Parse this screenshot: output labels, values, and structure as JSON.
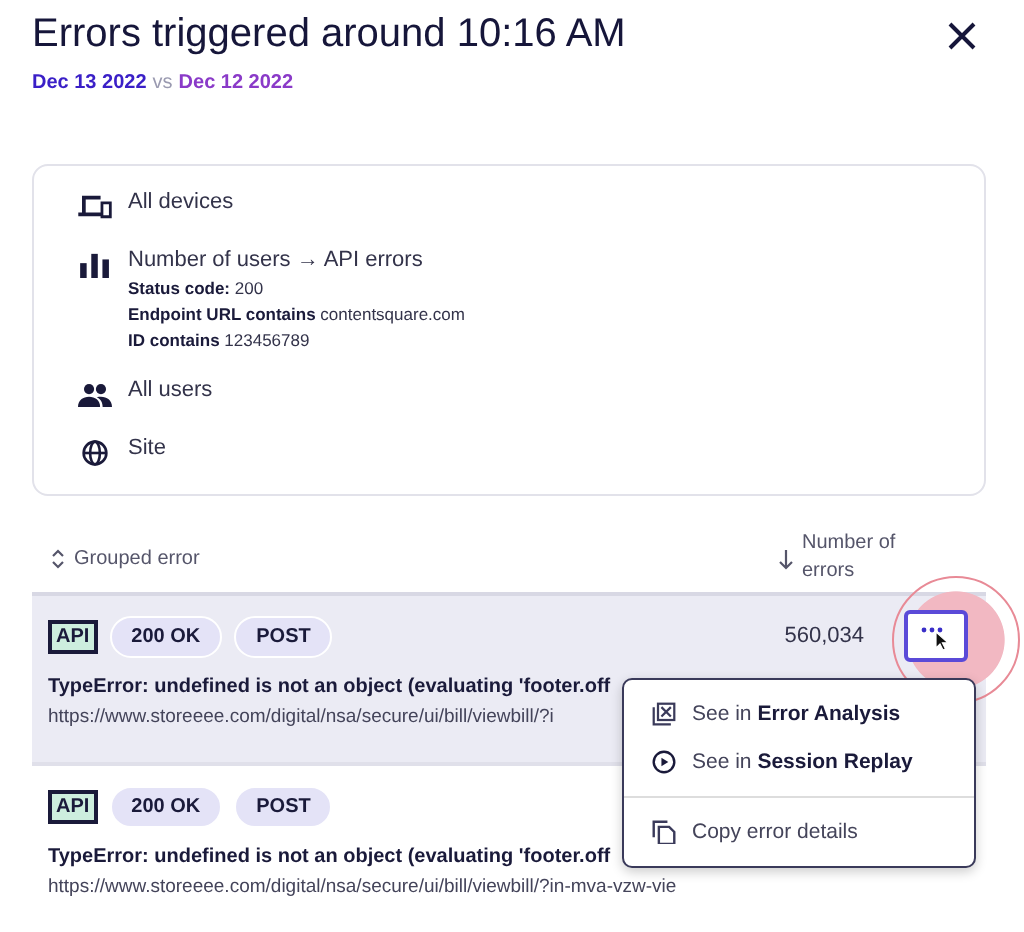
{
  "title": "Errors triggered around 10:16 AM",
  "comparison": {
    "current": "Dec 13 2022",
    "separator": "vs",
    "previous": "Dec 12 2022"
  },
  "filters": [
    {
      "kind": "devices",
      "label": "All devices"
    },
    {
      "kind": "metric",
      "label": "Number of users → API errors",
      "conditions": [
        "**Status code:** 200",
        "**Endpoint URL contains** contentsquare.com",
        "**ID contains** 123456789"
      ]
    },
    {
      "kind": "users",
      "label": "All users"
    },
    {
      "kind": "site",
      "label": "Site"
    }
  ],
  "table": {
    "columns": [
      {
        "label": "Grouped error",
        "kind": "sortable"
      },
      {
        "label": "Number of errors",
        "kind": "descending"
      }
    ],
    "rows": [
      {
        "selected": true,
        "type": "API",
        "status": "200 OK",
        "method": "POST",
        "error": "TypeError: undefined is not an object (evaluating 'footer.off",
        "url": "https://www.storeeee.com/digital/nsa/secure/ui/bill/viewbill/?i",
        "count": "560,034"
      },
      {
        "selected": false,
        "type": "API",
        "status": "200 OK",
        "method": "POST",
        "error": "TypeError: undefined is not an object (evaluating 'footer.off",
        "url": "https://www.storeeee.com/digital/nsa/secure/ui/bill/viewbill/?in-mva-vzw-vie"
      }
    ]
  },
  "menu": {
    "items": [
      {
        "kind": "analysis",
        "text": "See in **Error Analysis**"
      },
      {
        "kind": "replay",
        "text": "See in **Session Replay**"
      },
      {
        "kind": "copy",
        "text": "Copy error details",
        "divider_before": true
      }
    ]
  }
}
